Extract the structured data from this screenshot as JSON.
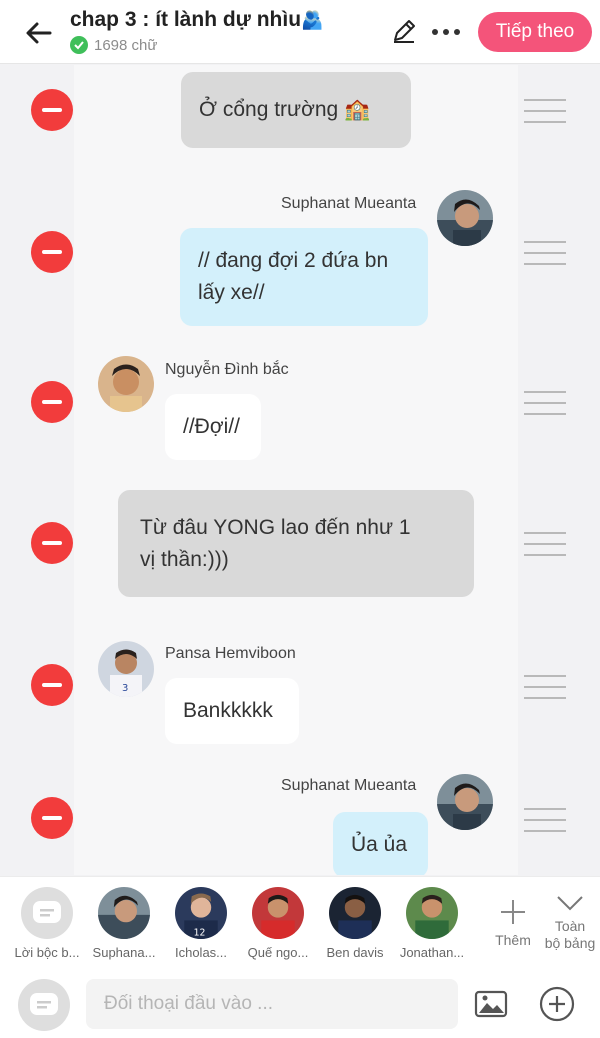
{
  "header": {
    "title": "chap 3 : ít lành dự nhìu",
    "title_emoji": "🫂",
    "word_count": "1698 chữ",
    "next_label": "Tiếp theo"
  },
  "messages": [
    {
      "type": "narration",
      "text": "Ở cổng trường 🏫"
    },
    {
      "type": "right",
      "name": "Suphanat Mueanta",
      "lines": [
        "// đang đợi 2 đứa bn",
        "lấy xe//"
      ]
    },
    {
      "type": "left",
      "name": "Nguyễn Đình bắc",
      "lines": [
        "//Đợi//"
      ]
    },
    {
      "type": "narration",
      "lines": [
        "Từ đâu YONG lao đến như 1",
        "vị thần:)))"
      ]
    },
    {
      "type": "left",
      "name": "Pansa Hemviboon",
      "lines": [
        "Bankkkkk"
      ]
    },
    {
      "type": "right",
      "name": "Suphanat Mueanta",
      "lines": [
        "Ủa ủa"
      ]
    }
  ],
  "characters": [
    {
      "label": "Lời bộc b...",
      "icon": "narrator-icon"
    },
    {
      "label": "Suphana..."
    },
    {
      "label": "Icholas..."
    },
    {
      "label": "Quế ngo..."
    },
    {
      "label": "Ben davis"
    },
    {
      "label": "Jonathan..."
    }
  ],
  "add_label": "Thêm",
  "all_label_1": "Toàn",
  "all_label_2": "bộ bảng",
  "input_placeholder": "Đối thoại đầu vào ...",
  "colors": {
    "accent": "#f4547a",
    "delete": "#f23c3c",
    "blue_bubble": "#d3f0fb",
    "gray_bubble": "#d9d9d9"
  }
}
